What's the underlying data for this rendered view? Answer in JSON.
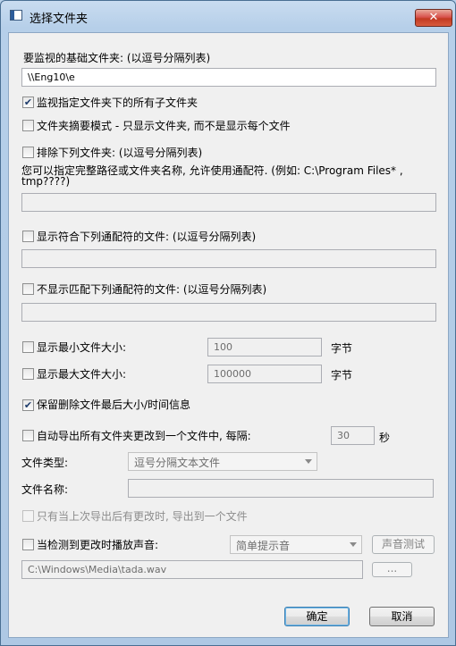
{
  "window": {
    "title": "选择文件夹",
    "close_glyph": "✕"
  },
  "base_folders": {
    "label": "要监视的基础文件夹: (以逗号分隔列表)",
    "value": "\\\\Eng10\\e"
  },
  "subfolders": {
    "label": "监视指定文件夹下的所有子文件夹",
    "checked": true
  },
  "summary_mode": {
    "label": "文件夹摘要模式 - 只显示文件夹, 而不是显示每个文件",
    "checked": false
  },
  "exclude": {
    "label": "排除下列文件夹: (以逗号分隔列表)",
    "checked": false,
    "help_line1": "您可以指定完整路径或文件夹名称, 允许使用通配符. (例如: C:\\Program Files* ,",
    "help_line2": "tmp????)",
    "value": ""
  },
  "include_wildcards": {
    "label": "显示符合下列通配符的文件: (以逗号分隔列表)",
    "checked": false,
    "value": ""
  },
  "exclude_wildcards": {
    "label": "不显示匹配下列通配符的文件: (以逗号分隔列表)",
    "checked": false,
    "value": ""
  },
  "min_size": {
    "label": "显示最小文件大小:",
    "checked": false,
    "value": "100",
    "unit": "字节"
  },
  "max_size": {
    "label": "显示最大文件大小:",
    "checked": false,
    "value": "100000",
    "unit": "字节"
  },
  "keep_deleted": {
    "label": "保留删除文件最后大小/时间信息",
    "checked": true
  },
  "auto_export": {
    "label": "自动导出所有文件夹更改到一个文件中, 每隔:",
    "checked": false,
    "interval": "30",
    "unit": "秒"
  },
  "file_type": {
    "label": "文件类型:",
    "selected": "逗号分隔文本文件"
  },
  "file_name": {
    "label": "文件名称:",
    "value": ""
  },
  "export_only_changed": {
    "label": "只有当上次导出后有更改时, 导出到一个文件",
    "checked": false
  },
  "sound": {
    "label": "当检测到更改时播放声音:",
    "checked": false,
    "selected": "简单提示音",
    "test_label": "声音测试",
    "path": "C:\\Windows\\Media\\tada.wav",
    "browse_label": "..."
  },
  "buttons": {
    "ok": "确定",
    "cancel": "取消"
  }
}
